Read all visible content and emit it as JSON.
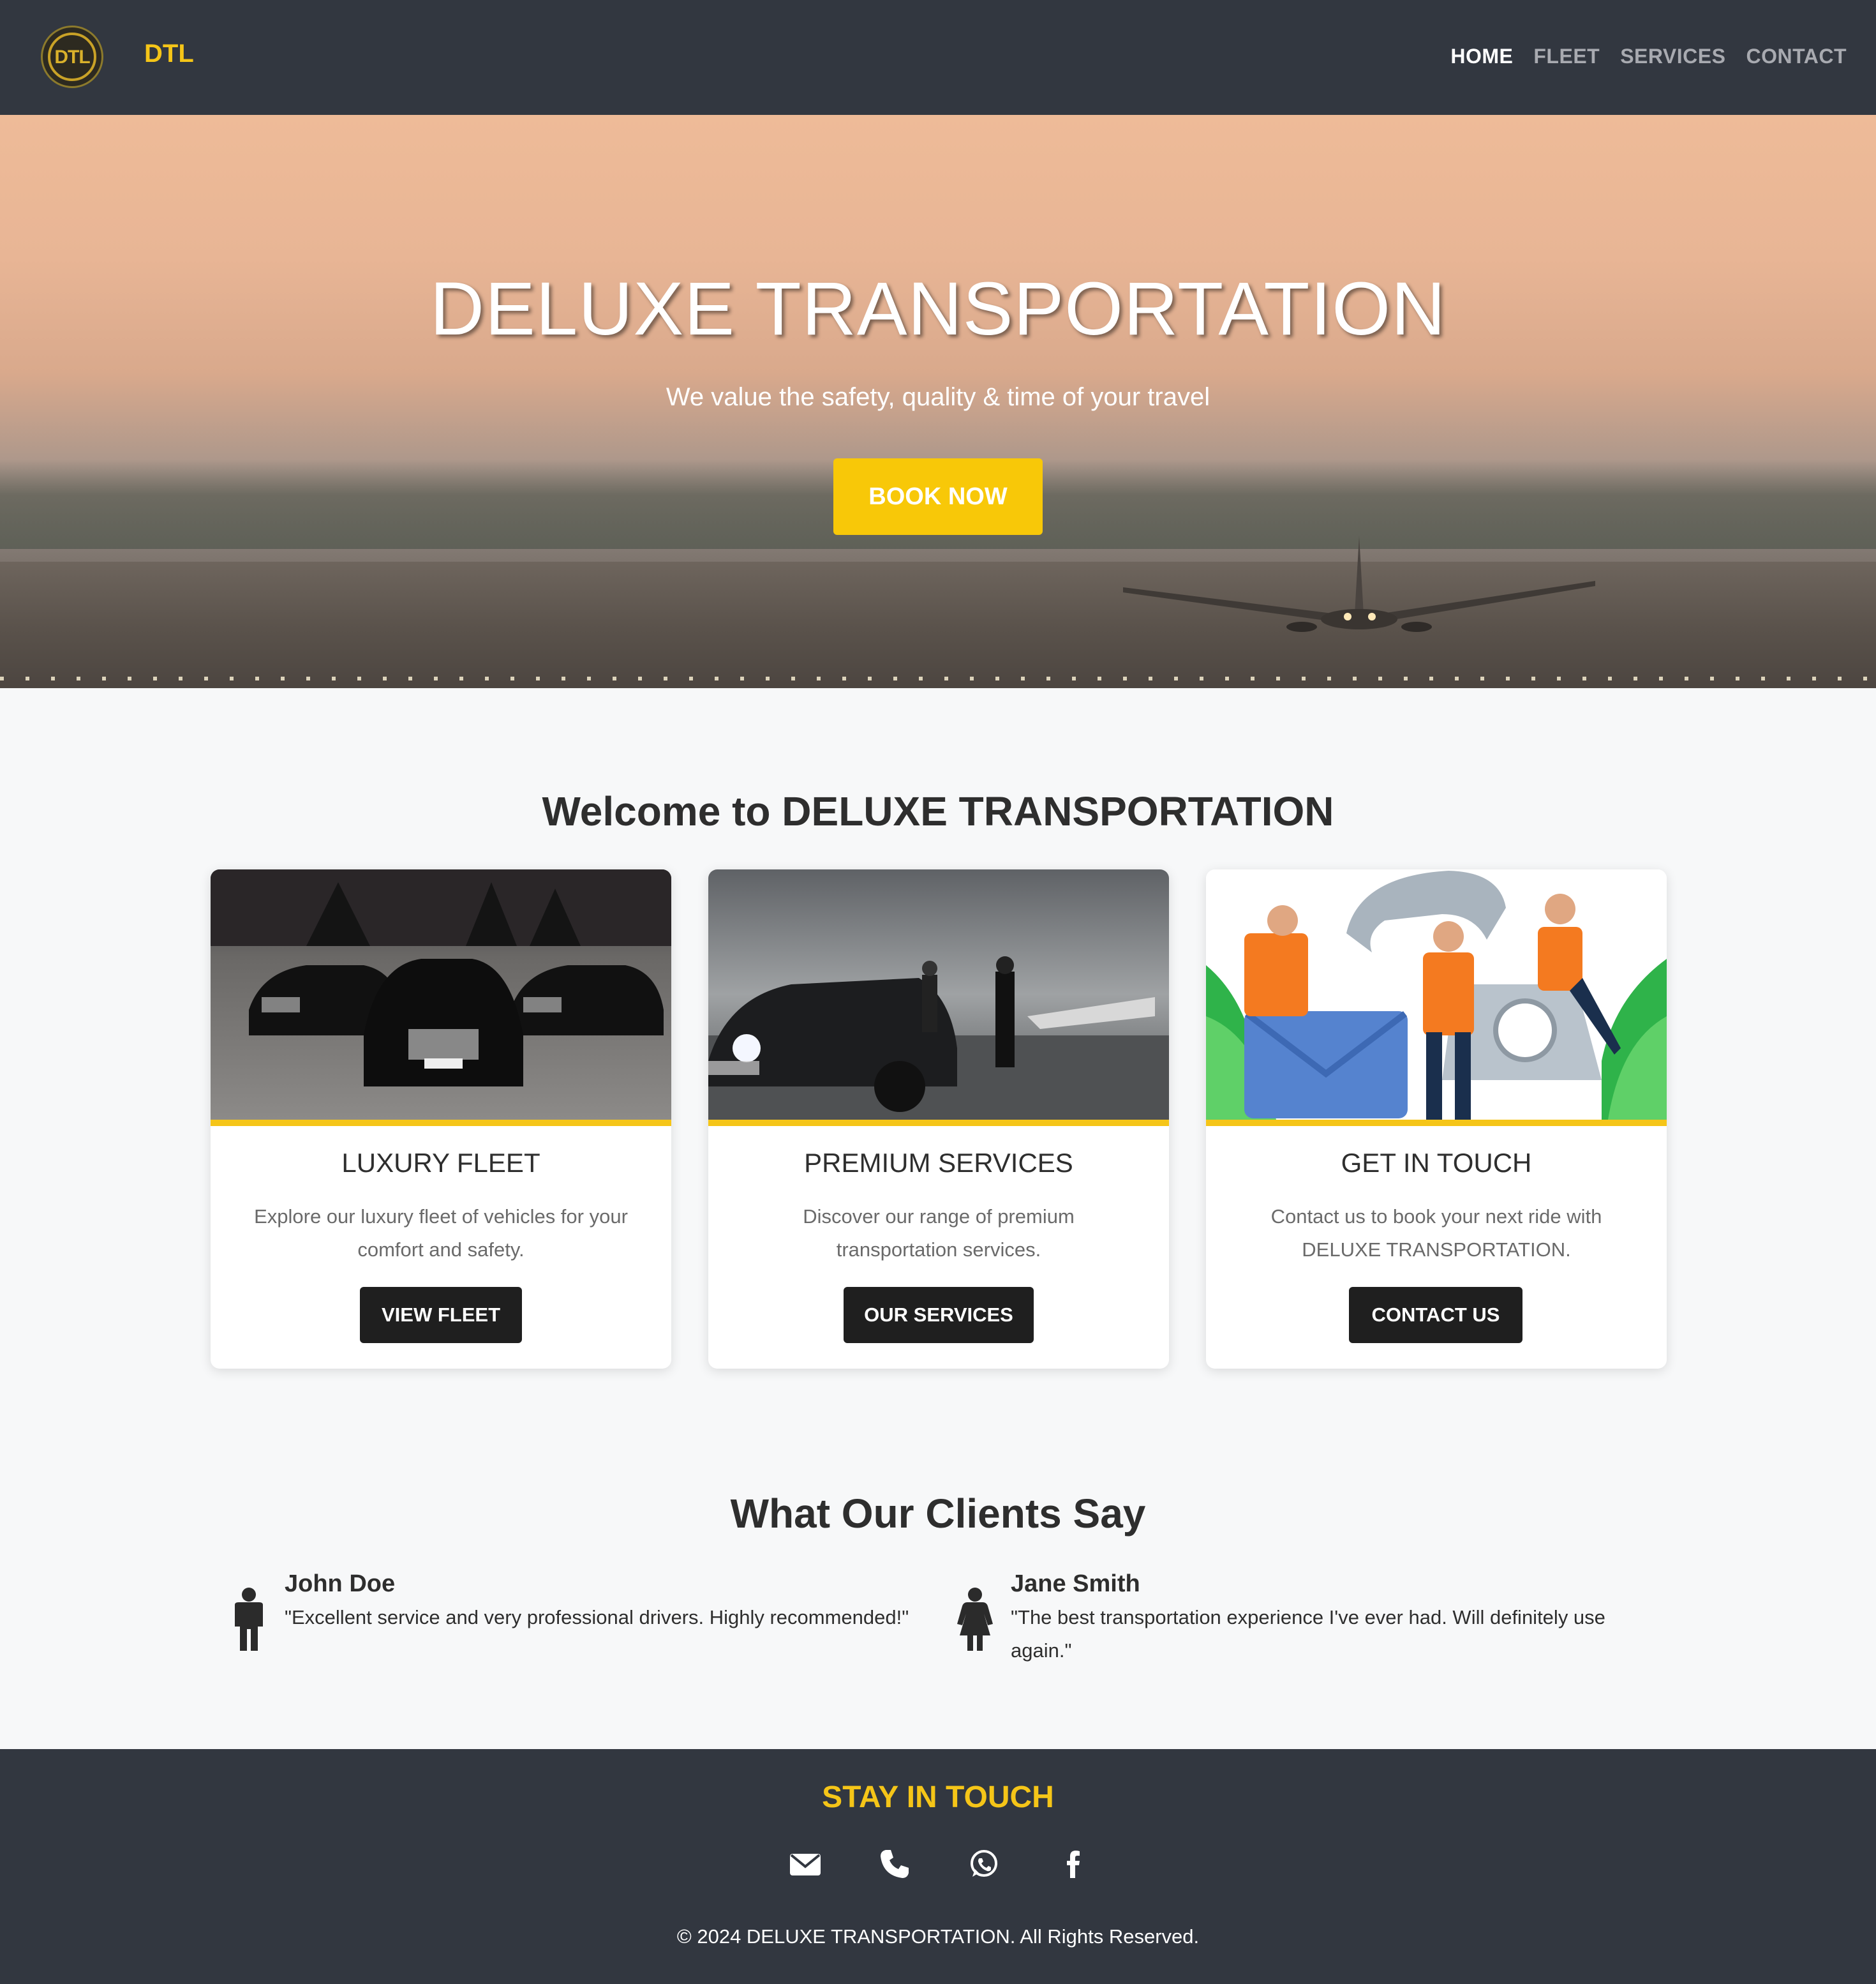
{
  "nav": {
    "logo_text": "DTL",
    "brand": "DTL",
    "links": [
      {
        "label": "HOME",
        "active": true
      },
      {
        "label": "FLEET",
        "active": false
      },
      {
        "label": "SERVICES",
        "active": false
      },
      {
        "label": "CONTACT",
        "active": false
      }
    ]
  },
  "hero": {
    "title": "DELUXE TRANSPORTATION",
    "subtitle": "We value the safety, quality & time of your travel",
    "cta": "BOOK NOW"
  },
  "welcome": {
    "title": "Welcome to DELUXE TRANSPORTATION",
    "cards": [
      {
        "title": "LUXURY FLEET",
        "text": "Explore our luxury fleet of vehicles for your comfort and safety.",
        "button": "VIEW FLEET",
        "image_alt": "black luxury cars"
      },
      {
        "title": "PREMIUM SERVICES",
        "text": "Discover our range of premium transportation services.",
        "button": "OUR SERVICES",
        "image_alt": "chauffeur opening car door"
      },
      {
        "title": "GET IN TOUCH",
        "text": "Contact us to book your next ride with DELUXE TRANSPORTATION.",
        "button": "CONTACT US",
        "image_alt": "contact illustration"
      }
    ]
  },
  "testimonials": {
    "title": "What Our Clients Say",
    "items": [
      {
        "name": "John Doe",
        "quote": "\"Excellent service and very professional drivers. Highly recommended!\"",
        "icon": "male-person-icon"
      },
      {
        "name": "Jane Smith",
        "quote": "\"The best transportation experience I've ever had. Will definitely use again.\"",
        "icon": "female-person-icon"
      }
    ]
  },
  "footer": {
    "title": "STAY IN TOUCH",
    "social_icons": [
      "envelope-icon",
      "phone-icon",
      "whatsapp-icon",
      "facebook-icon"
    ],
    "copyright": "© 2024 DELUXE TRANSPORTATION. All Rights Reserved."
  },
  "colors": {
    "accent": "#f5c518",
    "nav_bg": "#323740",
    "button_dark": "#1f1f1f",
    "page_bg": "#f7f8f9"
  }
}
